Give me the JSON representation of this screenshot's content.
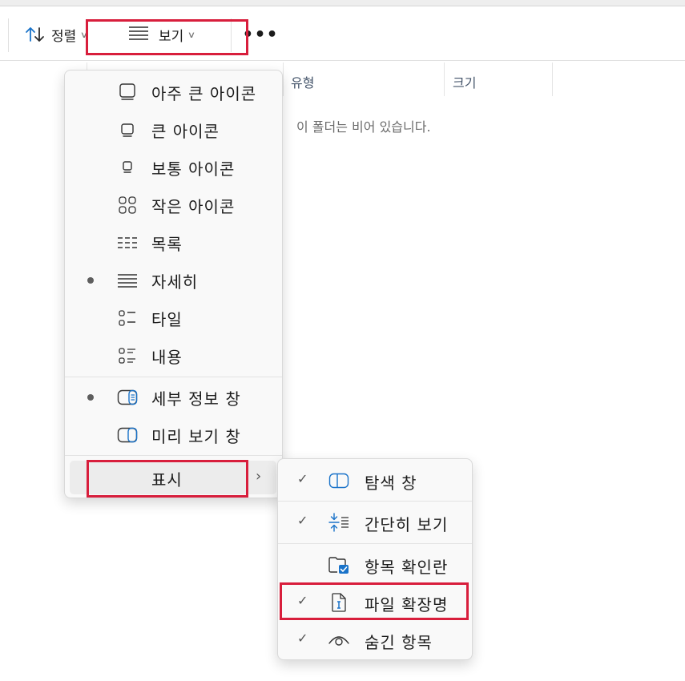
{
  "toolbar": {
    "sort_label": "정렬",
    "view_label": "보기",
    "more_label": "•••",
    "icons": {
      "sort": "sort-arrows-icon",
      "view": "details-lines-icon",
      "more": "more-dots-icon"
    }
  },
  "columns": {
    "type_label": "유형",
    "size_label": "크기"
  },
  "empty_message": "이 폴더는 비어 있습니다.",
  "view_menu": {
    "items": [
      {
        "label": "아주 큰 아이콘",
        "icon": "extra-large-icons-icon",
        "selected": false
      },
      {
        "label": "큰 아이콘",
        "icon": "large-icons-icon",
        "selected": false
      },
      {
        "label": "보통 아이콘",
        "icon": "medium-icons-icon",
        "selected": false
      },
      {
        "label": "작은 아이콘",
        "icon": "small-icons-icon",
        "selected": false
      },
      {
        "label": "목록",
        "icon": "list-icon",
        "selected": false
      },
      {
        "label": "자세히",
        "icon": "details-icon",
        "selected": true
      },
      {
        "label": "타일",
        "icon": "tiles-icon",
        "selected": false
      },
      {
        "label": "내용",
        "icon": "content-icon",
        "selected": false
      }
    ],
    "panes": [
      {
        "label": "세부 정보 창",
        "icon": "details-pane-icon",
        "selected": true
      },
      {
        "label": "미리 보기 창",
        "icon": "preview-pane-icon",
        "selected": false
      }
    ],
    "show_label": "표시",
    "show_arrow": "›"
  },
  "show_submenu": {
    "items": [
      {
        "label": "탐색 창",
        "icon": "navigation-pane-icon",
        "checked": true
      },
      {
        "label": "간단히 보기",
        "icon": "compact-view-icon",
        "checked": true
      },
      {
        "label": "항목 확인란",
        "icon": "item-checkboxes-icon",
        "checked": false
      },
      {
        "label": "파일 확장명",
        "icon": "file-extensions-icon",
        "checked": true
      },
      {
        "label": "숨긴 항목",
        "icon": "hidden-items-eye-icon",
        "checked": true
      }
    ],
    "check_glyph": "✓"
  },
  "colors": {
    "highlight": "#d81e3c",
    "accent": "#1a73c9",
    "menu_bg": "#f9f9f9"
  }
}
